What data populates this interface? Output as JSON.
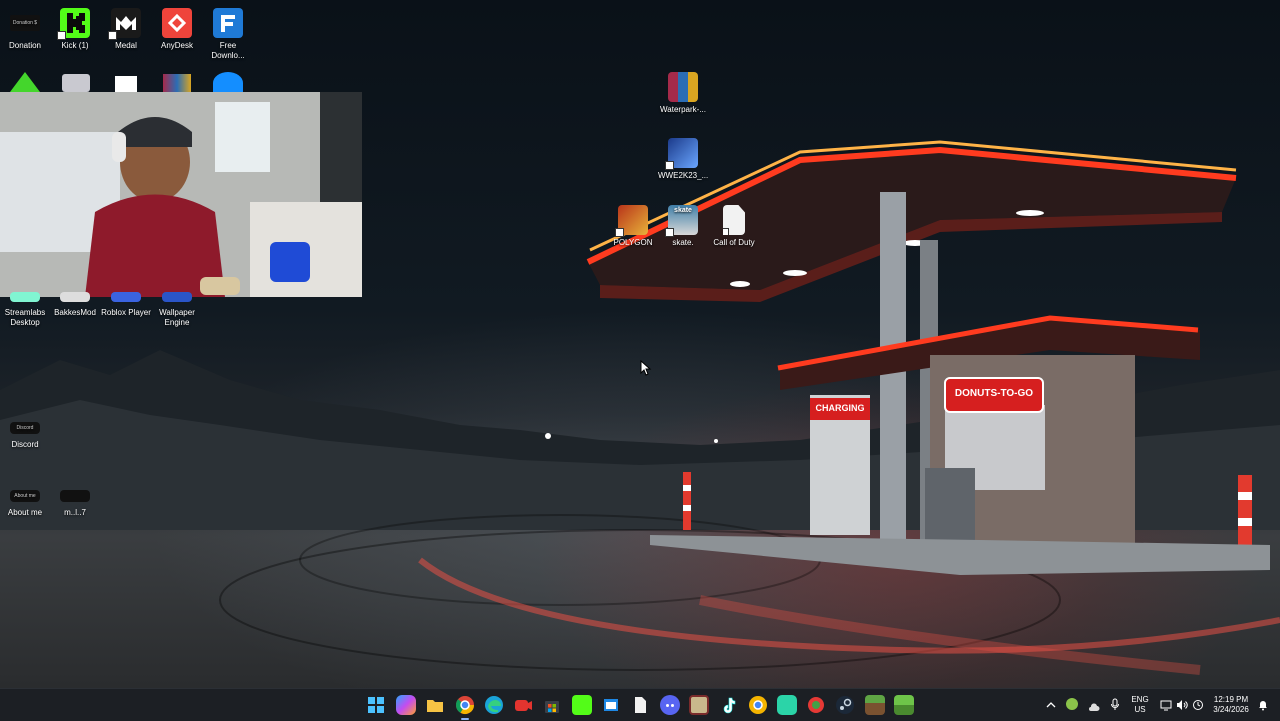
{
  "desktop_icons": {
    "donation": {
      "label": "Donation",
      "badge": "Donation $"
    },
    "kick": {
      "label": "Kick (1)"
    },
    "medal": {
      "label": "Medal"
    },
    "anydesk": {
      "label": "AnyDesk"
    },
    "free_download": {
      "label": "Free Downlo..."
    },
    "waterpark": {
      "label": "Waterpark-..."
    },
    "wwe2k23": {
      "label": "WWE2K23_..."
    },
    "polygon": {
      "label": "POLYGON"
    },
    "skate": {
      "label": "skate.",
      "badge": "skate"
    },
    "call_of_duty": {
      "label": "Call of Duty"
    },
    "streamlabs": {
      "label": "Streamlabs Desktop"
    },
    "bakkesmod": {
      "label": "BakkesMod"
    },
    "roblox_player": {
      "label": "Roblox Player"
    },
    "wallpaper_engine": {
      "label": "Wallpaper Engine"
    },
    "discord": {
      "label": "Discord",
      "badge": "Discord"
    },
    "about_me": {
      "label": "About me",
      "badge": "About me"
    },
    "ml7": {
      "label": "m..l..7"
    }
  },
  "wallpaper": {
    "sign_charging": "CHARGING",
    "sign_donuts": "DONUTS-TO-GO"
  },
  "taskbar": {
    "lang_top": "ENG",
    "lang_bottom": "US",
    "time": "12:19 PM",
    "date": "3/24/2026"
  },
  "colors": {
    "taskbar_bg": "#1c1f24",
    "neon_red": "#ff3b1f",
    "neon_orange": "#ffb347"
  }
}
